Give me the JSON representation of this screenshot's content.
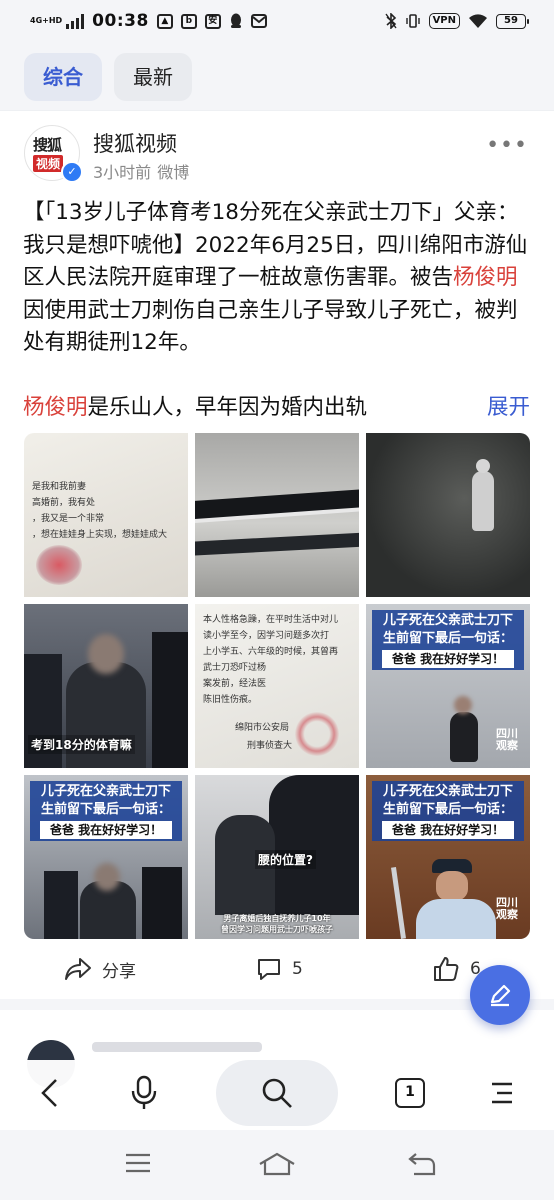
{
  "status_bar": {
    "network": "4G+HD",
    "time": "00:38",
    "icons": [
      "gallery-icon",
      "baidu-icon",
      "anbao-icon",
      "qq-icon",
      "mail-icon"
    ],
    "vpn": "VPN",
    "battery": "59"
  },
  "tabs": [
    {
      "label": "综合",
      "active": true
    },
    {
      "label": "最新",
      "active": false
    }
  ],
  "post": {
    "author": "搜狐视频",
    "avatar_line1": "搜狐",
    "avatar_line2": "视频",
    "time": "3小时前",
    "source": "微博",
    "text_1": "【「13岁儿子体育考18分死在父亲武士刀下」父亲：我只是想吓唬他】2022年6月25日，四川绵阳市游仙区人民法院开庭审理了一桩故意伤害罪。被告",
    "name": "杨俊明",
    "text_2": "因使用武士刀刺伤自己亲生儿子导致儿子死亡，被判处有期徒刑12年。",
    "last_name": "杨俊明",
    "last_text": "是乐山人，早年因为婚内出轨",
    "expand": "展开"
  },
  "photos": {
    "doc1": [
      "是我和我前妻",
      "高婚前，我有处",
      "，我又是一个非常",
      "，想在娃娃身上实现，想娃娃成大"
    ],
    "caption_line1": "儿子死在父亲武士刀下",
    "caption_line2": "生前留下最后一句话：",
    "caption_line3": "爸爸 我在好好学习！",
    "sub_18": "考到18分的体育嘛",
    "doc2": [
      "本人性格急躁，在平时生活中对儿",
      "读小学至今，因学习问题多次打",
      "上小学五、六年级的时候，其曾再",
      "武士刀恐吓过杨",
      "案发前，经法医",
      "陈旧性伤痕。",
      "绵阳市公安局",
      "刑事侦查大"
    ],
    "sub_where": "腰的位置?",
    "sub_bottom1": "男子离婚后独自抚养儿子10年",
    "sub_bottom2": "曾因学习问题用武士刀吓唬孩子",
    "watermark": "四川观察"
  },
  "actions": {
    "share": "分享",
    "comments": "5",
    "likes": "6"
  },
  "toolbar": {
    "tab_count": "1"
  }
}
